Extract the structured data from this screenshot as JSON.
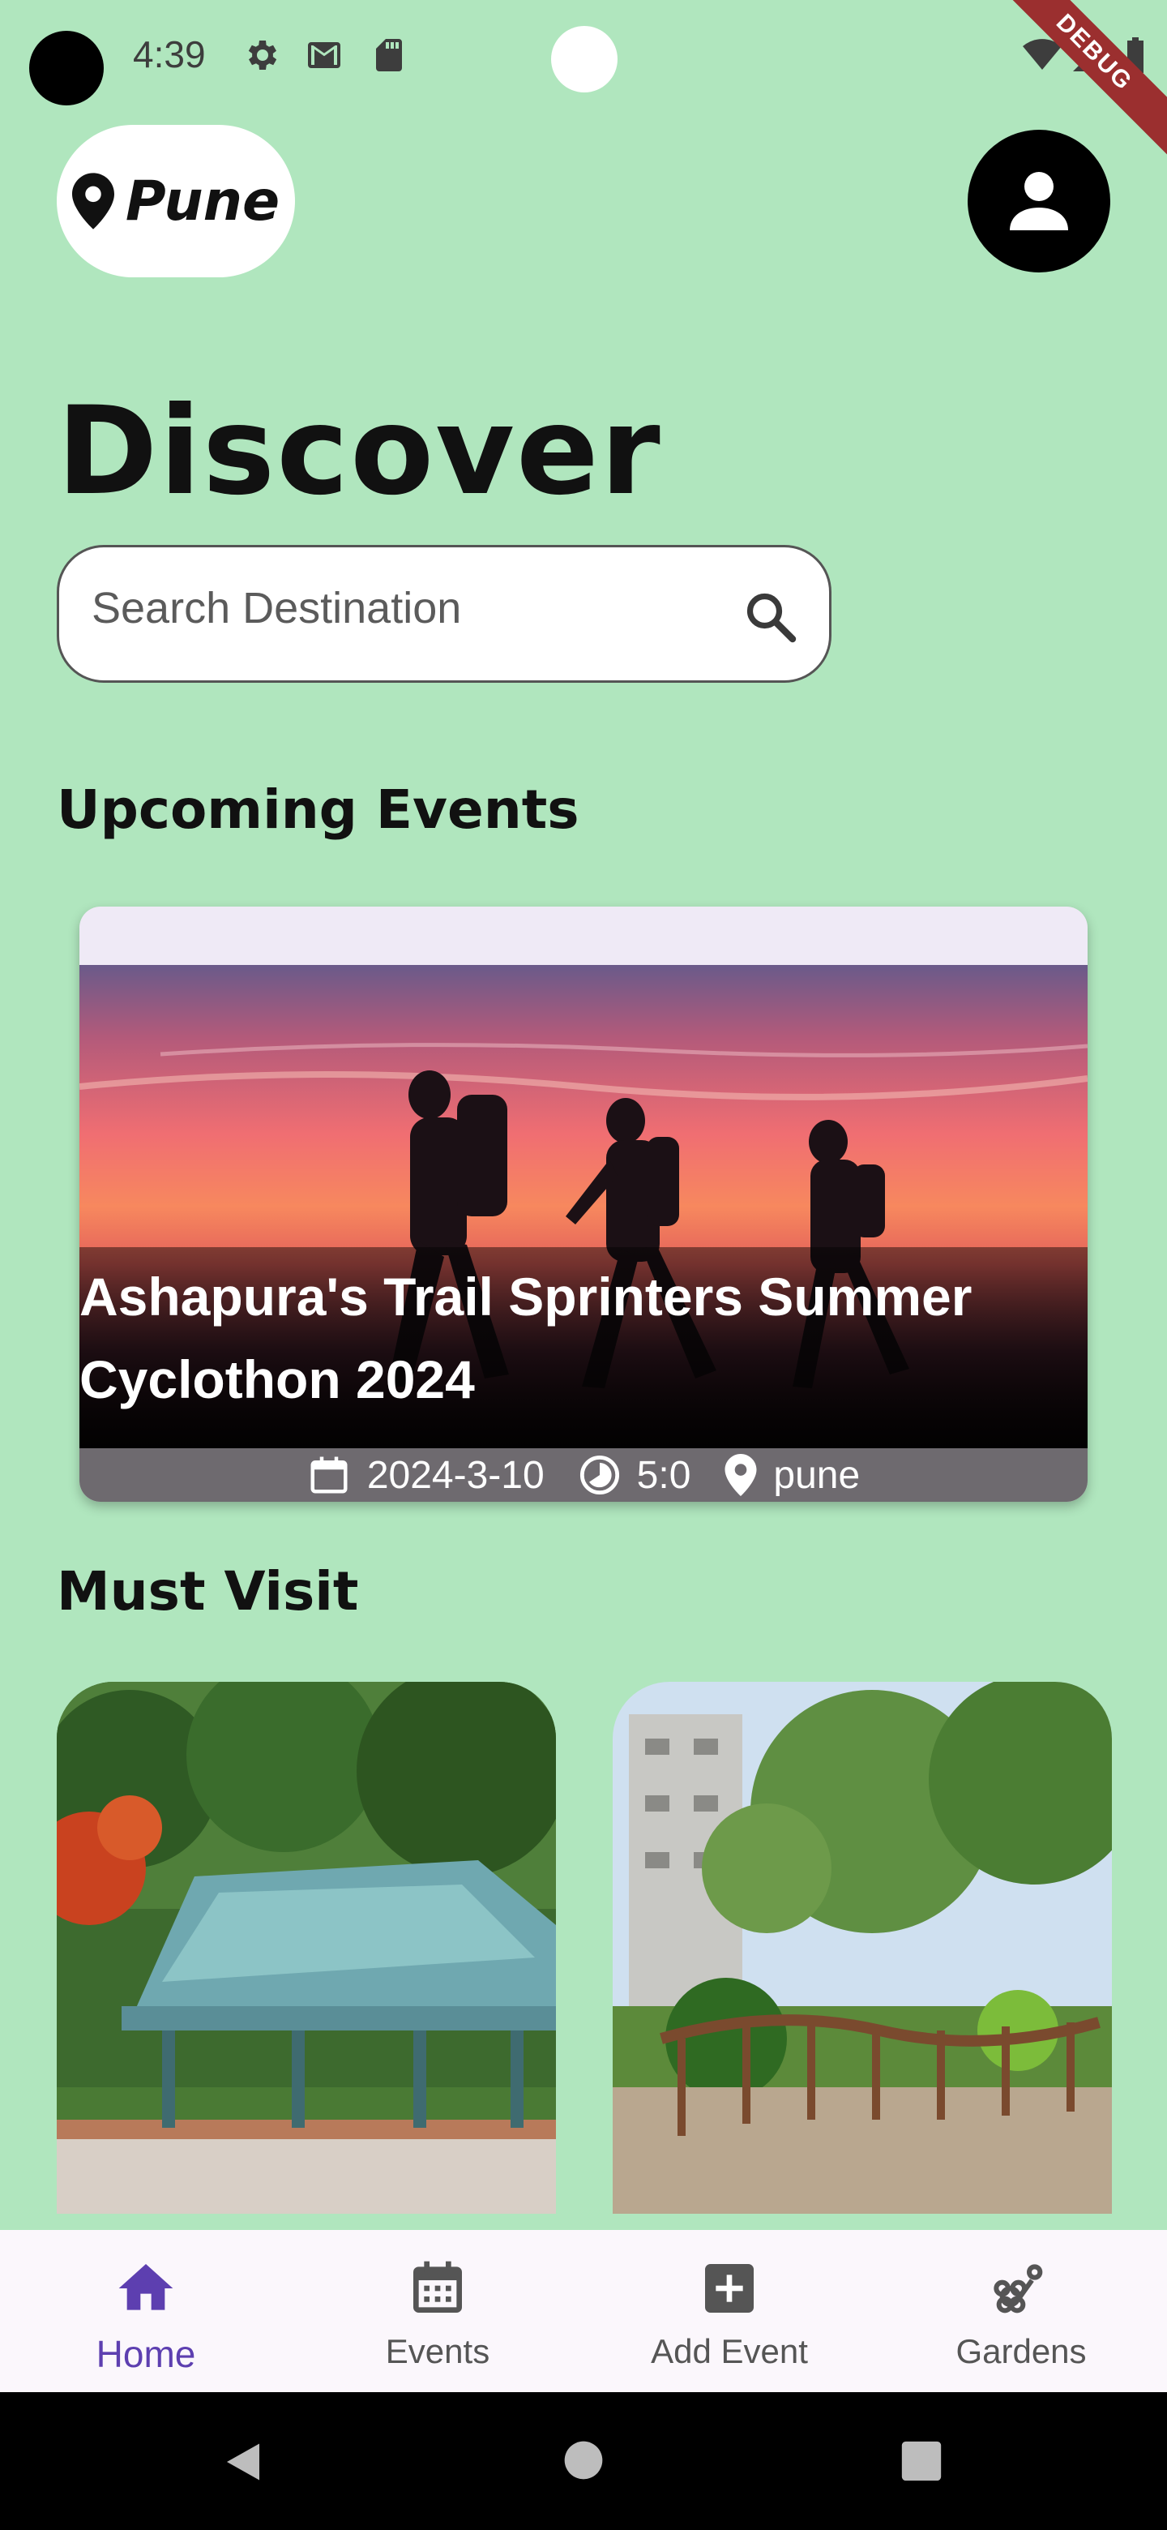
{
  "status_bar": {
    "time": "4:39",
    "icons": [
      "settings-icon",
      "gmail-icon",
      "sd-card-icon",
      "wifi-icon",
      "signal-icon",
      "battery-icon"
    ],
    "debug_label": "DEBUG"
  },
  "header": {
    "location": "Pune",
    "profile_icon": "person-icon"
  },
  "main": {
    "title": "Discover",
    "search": {
      "placeholder": "Search Destination"
    },
    "upcoming_title": "Upcoming Events",
    "event": {
      "title": "Ashapura's Trail Sprinters Summer Cyclothon 2024",
      "date": "2024-3-10",
      "time": "5:0",
      "place": "pune"
    },
    "must_visit_title": "Must Visit"
  },
  "bottom_nav": {
    "items": [
      {
        "label": "Home",
        "icon": "home-icon",
        "active": true
      },
      {
        "label": "Events",
        "icon": "calendar-icon",
        "active": false
      },
      {
        "label": "Add Event",
        "icon": "add-box-icon",
        "active": false
      },
      {
        "label": "Gardens",
        "icon": "flower-icon",
        "active": false
      }
    ]
  },
  "colors": {
    "background": "#b0e6be",
    "accent": "#5d3fb0",
    "nav_background": "#fbf7fc"
  }
}
